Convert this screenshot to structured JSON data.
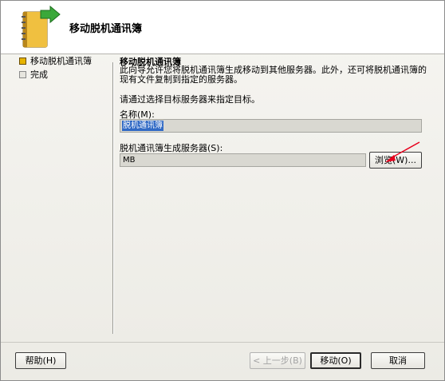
{
  "header": {
    "title": "移动脱机通讯簿",
    "icon": "address-book-move-icon",
    "colors": {
      "book": "#d8a421",
      "arrow": "#3aa83a"
    }
  },
  "steps": [
    {
      "label": "移动脱机通讯簿",
      "active": true
    },
    {
      "label": "完成",
      "active": false
    }
  ],
  "main": {
    "heading": "移动脱机通讯簿",
    "description": "此向导允许您将脱机通讯簿生成移动到其他服务器。此外，还可将脱机通讯簿的现有文件复制到指定的服务器。",
    "prompt": "请通过选择目标服务器来指定目标。",
    "name_label": "名称(M):",
    "name_value": "脱机通讯簿",
    "server_label": "脱机通讯簿生成服务器(S):",
    "server_value": "MB",
    "browse_label": "浏览(W)..."
  },
  "buttons": {
    "help": "帮助(H)",
    "back": "< 上一步(B)",
    "move": "移动(O)",
    "cancel": "取消"
  },
  "annotation": {
    "color": "#e8001c",
    "icon": "red-arrow-annotation"
  }
}
